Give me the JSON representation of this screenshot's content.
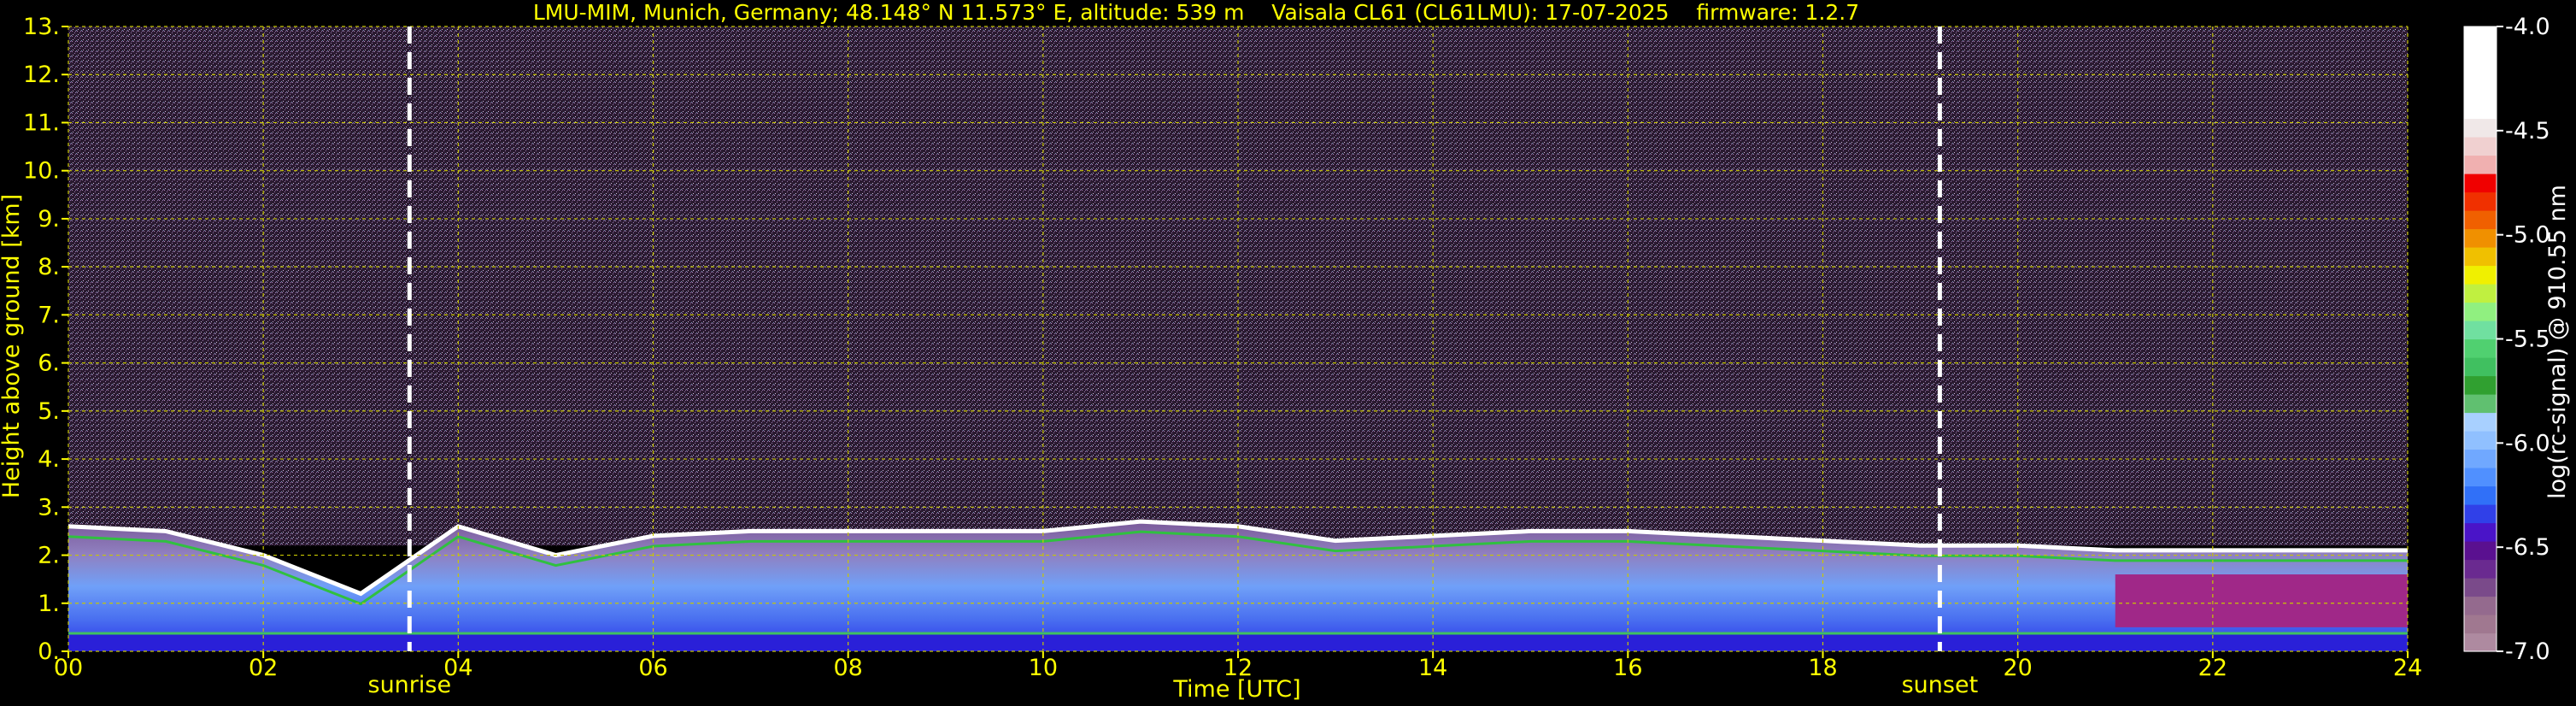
{
  "chart_data": {
    "type": "heatmap",
    "title": "LMU-MIM, Munich, Germany; 48.148° N 11.573° E, altitude: 539 m    Vaisala CL61 (CL61LMU): 17-07-2025    firmware: 1.2.7",
    "xlabel": "Time [UTC]",
    "ylabel": "Height above ground [km]",
    "xlim": [
      0,
      24
    ],
    "ylim": [
      0,
      13
    ],
    "x_ticks": [
      0,
      2,
      4,
      6,
      8,
      10,
      12,
      14,
      16,
      18,
      20,
      22,
      24
    ],
    "x_tick_labels": [
      "00",
      "02",
      "04",
      "06",
      "08",
      "10",
      "12",
      "14",
      "16",
      "18",
      "20",
      "22",
      "24"
    ],
    "y_ticks": [
      0,
      1,
      2,
      3,
      4,
      5,
      6,
      7,
      8,
      9,
      10,
      11,
      12,
      13
    ],
    "y_tick_labels": [
      "0.",
      "1.",
      "2.",
      "3.",
      "4.",
      "5.",
      "6.",
      "7.",
      "8.",
      "9.",
      "10.",
      "11.",
      "12.",
      "13."
    ],
    "grid": true,
    "colorbar": {
      "label": "log(rc-signal) @ 910.55 nm",
      "range": [
        -7.0,
        -4.0
      ],
      "ticks": [
        -7.0,
        -6.5,
        -6.0,
        -5.5,
        -5.0,
        -4.5,
        -4.0
      ],
      "tick_labels": [
        "-7.0",
        "-6.5",
        "-6.0",
        "-5.5",
        "-5.0",
        "-4.5",
        "-4.0"
      ],
      "colors": [
        "#ae8aa0",
        "#a07890",
        "#946a8e",
        "#7a4a8a",
        "#6a2a90",
        "#5a1090",
        "#4a14c8",
        "#3040e8",
        "#3070f8",
        "#5090ff",
        "#70a8ff",
        "#90c0ff",
        "#a8d0ff",
        "#60c070",
        "#30a030",
        "#40c060",
        "#50d070",
        "#70e0a0",
        "#90f080",
        "#c0f040",
        "#f0f000",
        "#f0c000",
        "#f09000",
        "#f06000",
        "#f03000",
        "#f00000",
        "#f0b0b0",
        "#f0d0d0",
        "#f0e8e8",
        "#ffffff",
        "#ffffff",
        "#ffffff",
        "#ffffff",
        "#ffffff"
      ]
    },
    "events": [
      {
        "label": "sunrise",
        "time": 3.5
      },
      {
        "label": "sunset",
        "time": 19.2
      }
    ],
    "layers": [
      {
        "name": "boundary_layer_top_km",
        "x": [
          0,
          1,
          2,
          3,
          4,
          5,
          6,
          7,
          8,
          9,
          10,
          11,
          12,
          13,
          14,
          15,
          16,
          17,
          18,
          19,
          20,
          21,
          22,
          23,
          24
        ],
        "y": [
          2.6,
          2.5,
          2.0,
          1.2,
          2.6,
          2.0,
          2.4,
          2.5,
          2.5,
          2.5,
          2.5,
          2.7,
          2.6,
          2.3,
          2.4,
          2.5,
          2.5,
          2.4,
          2.3,
          2.2,
          2.2,
          2.1,
          2.1,
          2.1,
          2.1
        ]
      }
    ]
  }
}
